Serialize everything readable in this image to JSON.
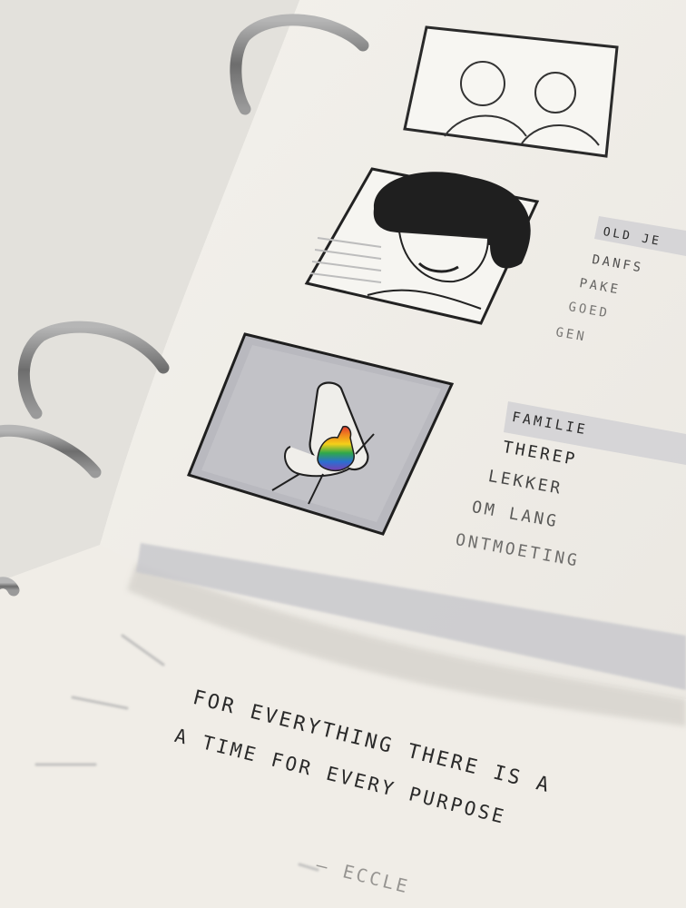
{
  "page_labels": [
    "OLD JE",
    "DANFS",
    "PAKE",
    "GOED",
    "GEN",
    "FAMILIE",
    "THEREP",
    "LEKKER",
    "OM LANG",
    "ONTMOETING"
  ],
  "quote": {
    "line1": "FOR EVERYTHING THERE IS A",
    "line2": "A TIME FOR EVERY PURPOSE",
    "attribution": "— ECCLE"
  },
  "colors": {
    "paper": "#f1eee8",
    "ink": "#2a2a2a",
    "ring": "#8c8c8c",
    "highlight": "#c9c9cd"
  }
}
